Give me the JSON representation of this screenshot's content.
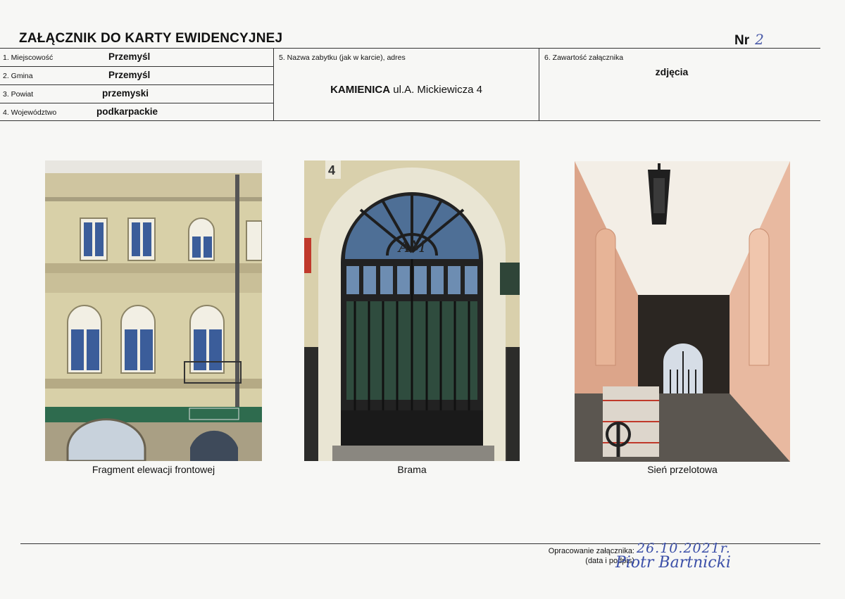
{
  "header": {
    "title": "ZAŁĄCZNIK DO KARTY EWIDENCYJNEJ",
    "nr_label": "Nr",
    "nr_value": "2"
  },
  "fields": [
    {
      "label": "1. Miejscowość",
      "value": "Przemyśl"
    },
    {
      "label": "2. Gmina",
      "value": "Przemyśl"
    },
    {
      "label": "3. Powiat",
      "value": "przemyski"
    },
    {
      "label": "4. Województwo",
      "value": "podkarpackie"
    }
  ],
  "monument": {
    "label": "5. Nazwa zabytku (jak w karcie), adres",
    "name": "KAMIENICA",
    "address": "ul.A. Mickiewicza 4"
  },
  "contents": {
    "label": "6. Zawartość załącznika",
    "value": "zdjęcia"
  },
  "photos": [
    {
      "caption": "Fragment elewacji frontowej"
    },
    {
      "caption": "Brama",
      "house_number": "4",
      "monogram": "AM"
    },
    {
      "caption": "Sień przelotowa"
    }
  ],
  "footer": {
    "label_line1": "Opracowanie załącznika:",
    "label_line2": "(data i podpis)",
    "date": "26.10.2021r.",
    "signature": "Piotr Bartnicki"
  },
  "colors": {
    "handwriting": "#3b4fa8"
  }
}
